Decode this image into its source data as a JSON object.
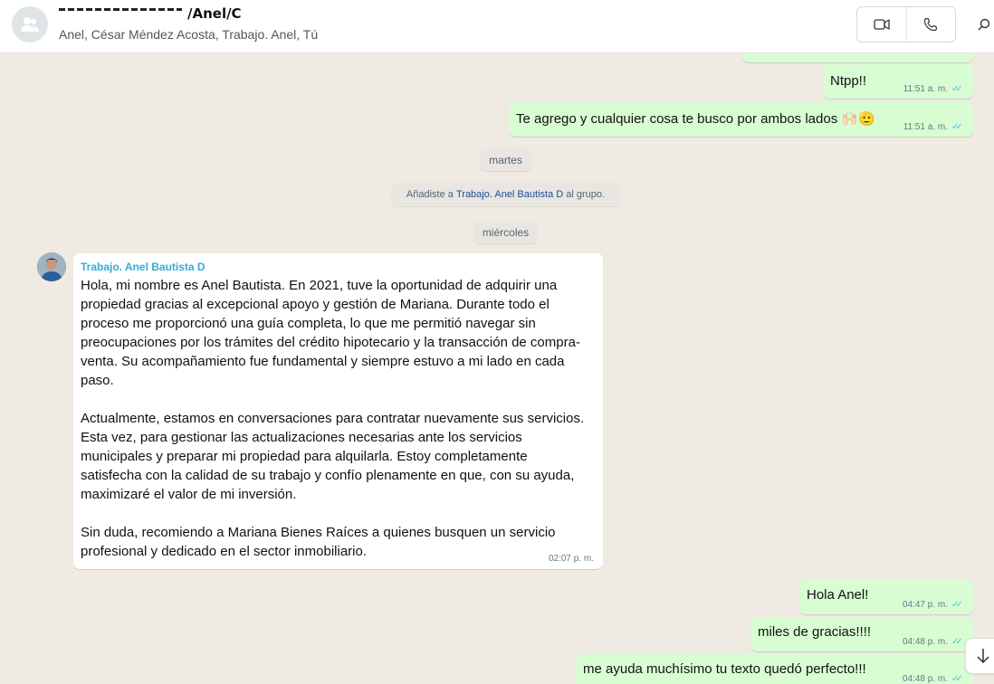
{
  "header": {
    "title_visible": "/Anel/C",
    "participants": "Anel, César Méndez Acosta, Trabajo. Anel, Tú"
  },
  "messages_top": [
    {
      "text": "Ntpp!!",
      "time": "11:51 a. m."
    },
    {
      "text": "Te agrego y cualquier cosa te busco por ambos lados 🙌🏻🫡",
      "time": "11:51 a. m."
    }
  ],
  "system": {
    "day1": "martes",
    "added_prefix": "Añadiste a",
    "added_link": "Trabajo. Anel Bautista D",
    "added_suffix": "al grupo.",
    "day2": "miércoles"
  },
  "incoming": {
    "sender": "Trabajo. Anel Bautista D",
    "paragraphs": [
      "Hola, mi nombre es Anel Bautista. En 2021, tuve la oportunidad de adquirir una propiedad gracias al excepcional apoyo y gestión de Mariana. Durante todo el proceso me proporcionó una guía completa, lo que me permitió navegar sin preocupaciones por los trámites del crédito hipotecario y la transacción de compra-venta. Su acompañamiento fue fundamental y siempre estuvo a mi lado en cada paso.",
      "Actualmente, estamos en conversaciones para contratar nuevamente sus servicios. Esta vez, para gestionar las actualizaciones necesarias ante los servicios municipales y preparar mi propiedad para alquilarla. Estoy completamente satisfecha con la calidad de su trabajo y confío plenamente en que, con su ayuda, maximizaré el valor de mi inversión.",
      "Sin duda, recomiendo a Mariana Bienes Raíces a quienes busquen un servicio profesional y dedicado en el sector inmobiliario."
    ],
    "time": "02:07 p. m."
  },
  "messages_bottom": [
    {
      "text": "Hola Anel!",
      "time": "04:47 p. m."
    },
    {
      "text": "miles de gracias!!!!",
      "time": "04:48 p. m."
    },
    {
      "text": "me ayuda muchísimo tu texto quedó perfecto!!!",
      "time": "04:48 p. m."
    }
  ],
  "icons": {
    "ticks": "✓✓"
  }
}
